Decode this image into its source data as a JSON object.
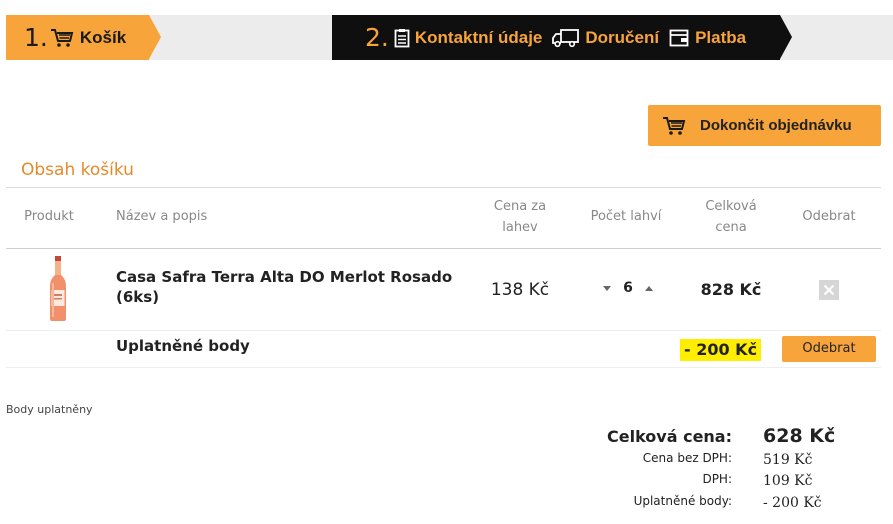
{
  "steps": [
    {
      "number": "1.",
      "label": "Košík"
    },
    {
      "number": "2.",
      "labels": [
        "Kontaktní údaje",
        "Doručení",
        "Platba"
      ]
    }
  ],
  "finish_button": {
    "label": "Dokončit objednávku"
  },
  "cart": {
    "title": "Obsah košíku",
    "headers": {
      "product": "Produkt",
      "name": "Název a popis",
      "price_line1": "Cena za",
      "price_line2": "lahev",
      "quantity": "Počet lahví",
      "total_line1": "Celková",
      "total_line2": "cena",
      "remove": "Odebrat"
    },
    "items": [
      {
        "name": "Casa Safra Terra Alta DO Merlot Rosado (6ks)",
        "price": "138 Kč",
        "quantity": "6",
        "total": "828 Kč"
      }
    ],
    "points_row": {
      "label": "Uplatněné body",
      "value": "- 200 Kč",
      "button": "Odebrat"
    }
  },
  "note": "Body uplatněny",
  "summary": {
    "total_label": "Celková cena:",
    "total_value": "628 Kč",
    "net_label": "Cena bez DPH:",
    "net_value": "519 Kč",
    "vat_label": "DPH:",
    "vat_value": "109 Kč",
    "points_label": "Uplatněné body:",
    "points_value": "- 200 Kč"
  },
  "colors": {
    "accent": "#f7a43a",
    "dark_step": "#0f0f0f",
    "inactive_step": "#ececec",
    "cart_title": "#e58a2b",
    "highlight": "#ffee00"
  },
  "icons": [
    "cart-icon",
    "clipboard-icon",
    "truck-icon",
    "wallet-icon",
    "close-icon",
    "arrow-down-icon",
    "arrow-up-icon"
  ]
}
